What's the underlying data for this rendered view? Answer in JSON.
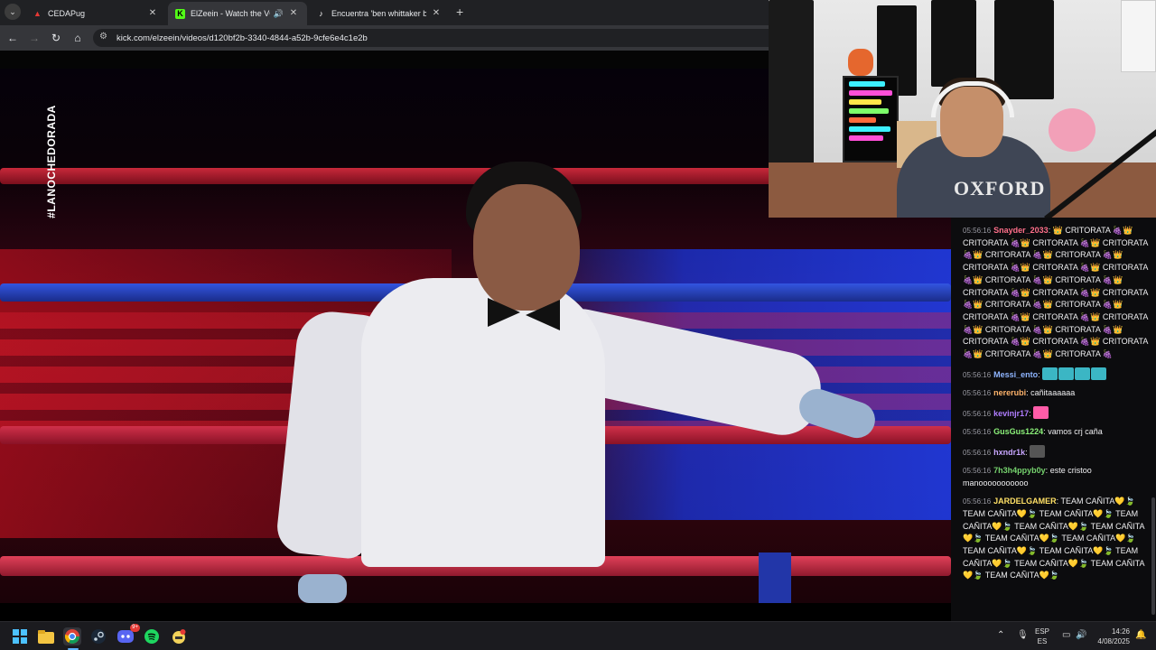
{
  "browser": {
    "tabs": [
      {
        "title": "CEDAPug",
        "active": false,
        "favicon": "cedapug-icon"
      },
      {
        "title": "ElZeein - Watch the VOD on",
        "active": true,
        "favicon": "kick-icon",
        "audio": true
      },
      {
        "title": "Encuentra 'ben whittaker boxin",
        "active": false,
        "favicon": "tiktok-icon"
      }
    ],
    "tab_close": "✕",
    "new_tab": "+",
    "url": "kick.com/elzeein/videos/d120bf2b-3340-4844-a52b-9cfe6e4c1e2b"
  },
  "video": {
    "overlay_hashtag": "#LANOCHEDORADA"
  },
  "webcam": {
    "shirt_text": "OXFORD"
  },
  "chat": {
    "messages": [
      {
        "time": "05:56:16",
        "user": "Snayder_2033",
        "color": "#ff6f8a",
        "text": "👑 CRITORATA 🍇👑 CRITORATA 🍇👑 CRITORATA 🍇👑 CRITORATA 🍇👑 CRITORATA 🍇👑 CRITORATA 🍇👑 CRITORATA 🍇👑 CRITORATA 🍇👑 CRITORATA 🍇👑 CRITORATA 🍇👑 CRITORATA 🍇👑 CRITORATA 🍇👑 CRITORATA 🍇👑 CRITORATA 🍇👑 CRITORATA 🍇👑 CRITORATA 🍇👑 CRITORATA 🍇👑 CRITORATA 🍇👑 CRITORATA 🍇👑 CRITORATA 🍇👑 CRITORATA 🍇👑 CRITORATA 🍇👑 CRITORATA 🍇👑 CRITORATA 🍇👑 CRITORATA 🍇👑 CRITORATA 🍇"
      },
      {
        "time": "05:56:16",
        "user": "Messi_ento",
        "color": "#8fb5ff",
        "text": "",
        "emotes": 4
      },
      {
        "time": "05:56:16",
        "user": "nererubi",
        "color": "#ffb36b",
        "text": "cañitaaaaaa"
      },
      {
        "time": "05:56:16",
        "user": "kevinjr17",
        "color": "#b07dff",
        "text": "",
        "emotes": 1
      },
      {
        "time": "05:56:16",
        "user": "GusGus1224",
        "color": "#8cf27a",
        "text": "vamos crj caña"
      },
      {
        "time": "05:56:16",
        "user": "hxndr1k",
        "color": "#c8a6ff",
        "text": "",
        "emotes": 1
      },
      {
        "time": "05:56:16",
        "user": "7h3h4ppyb0y",
        "color": "#76d36e",
        "text": "este cristoo manooooooooooo"
      },
      {
        "time": "05:56:16",
        "user": "JARDELGAMER",
        "color": "#ffe066",
        "text": "TEAM CAÑITA💛🍃 TEAM CAÑITA💛🍃 TEAM CAÑITA💛🍃 TEAM CAÑITA💛🍃 TEAM CAÑITA💛🍃 TEAM CAÑITA💛🍃 TEAM CAÑITA💛🍃 TEAM CAÑITA💛🍃 TEAM CAÑITA💛🍃 TEAM CAÑITA💛🍃 TEAM CAÑITA💛🍃 TEAM CAÑITA💛🍃 TEAM CAÑITA💛🍃 TEAM CAÑITA💛🍃"
      }
    ]
  },
  "taskbar": {
    "lang_top": "ESP",
    "lang_bottom": "ES",
    "time": "14:26",
    "date": "4/08/2025",
    "discord_badge": "9+",
    "icons": [
      "windows-start-icon",
      "file-explorer-icon",
      "chrome-icon",
      "steam-icon",
      "discord-icon",
      "spotify-icon",
      "app-icon"
    ]
  },
  "colors": {
    "chat_bg": "#0c0c0e",
    "chrome_bg": "#202124",
    "taskbar_bg": "#1b1b1f"
  }
}
